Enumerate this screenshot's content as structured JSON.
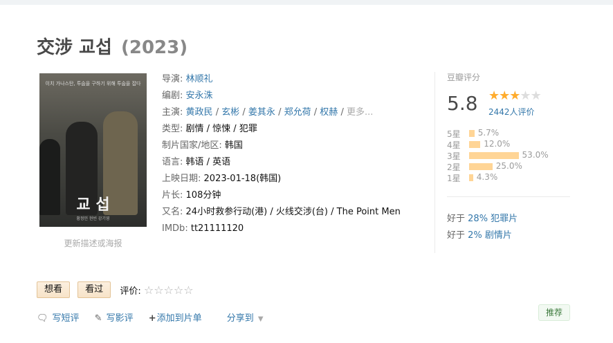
{
  "title": {
    "name": "交涉 교섭",
    "year": "(2023)"
  },
  "poster": {
    "top_text": "이치 가나스탄, 투숩을 구하기 위해 투숩을 잡다",
    "title_text": "교 섭",
    "bottom_text": "황정민 현빈 강기영",
    "link_label": "更新描述或海报"
  },
  "info": {
    "director_label": "导演:",
    "director": "林顺礼",
    "writer_label": "编剧:",
    "writer": "安永洙",
    "cast_label": "主演:",
    "cast": [
      "黄政民",
      "玄彬",
      "姜其永",
      "郑允荷",
      "权赫"
    ],
    "cast_sep": "/",
    "cast_more": "更多...",
    "genre_label": "类型:",
    "genre": "剧情 / 惊悚 / 犯罪",
    "country_label": "制片国家/地区:",
    "country": "韩国",
    "language_label": "语言:",
    "language": "韩语 / 英语",
    "release_label": "上映日期:",
    "release": "2023-01-18(韩国)",
    "runtime_label": "片长:",
    "runtime": "108分钟",
    "aka_label": "又名:",
    "aka": "24小时救参行动(港) / 火线交涉(台) / The Point Men",
    "imdb_label": "IMDb:",
    "imdb": "tt21111120"
  },
  "rating": {
    "label": "豆瓣评分",
    "score": "5.8",
    "stars_filled": 3,
    "stars_total": 5,
    "people": "2442人评价",
    "distribution": [
      {
        "label": "5星",
        "percent": 5.7,
        "text": "5.7%"
      },
      {
        "label": "4星",
        "percent": 12.0,
        "text": "12.0%"
      },
      {
        "label": "3星",
        "percent": 53.0,
        "text": "53.0%"
      },
      {
        "label": "2星",
        "percent": 25.0,
        "text": "25.0%"
      },
      {
        "label": "1星",
        "percent": 4.3,
        "text": "4.3%"
      }
    ]
  },
  "better_than": [
    {
      "prefix": "好于",
      "value": "28% 犯罪片"
    },
    {
      "prefix": "好于",
      "value": "2% 剧情片"
    }
  ],
  "actions": {
    "want": "想看",
    "watched": "看过",
    "rate_label": "评价:"
  },
  "links": {
    "short_review": "写短评",
    "review": "写影评",
    "add_list": "添加到片单",
    "share": "分享到"
  },
  "recommend": "推荐",
  "colors": {
    "link": "#3377aa",
    "star": "#ffac2d",
    "bar": "#ffd596"
  }
}
